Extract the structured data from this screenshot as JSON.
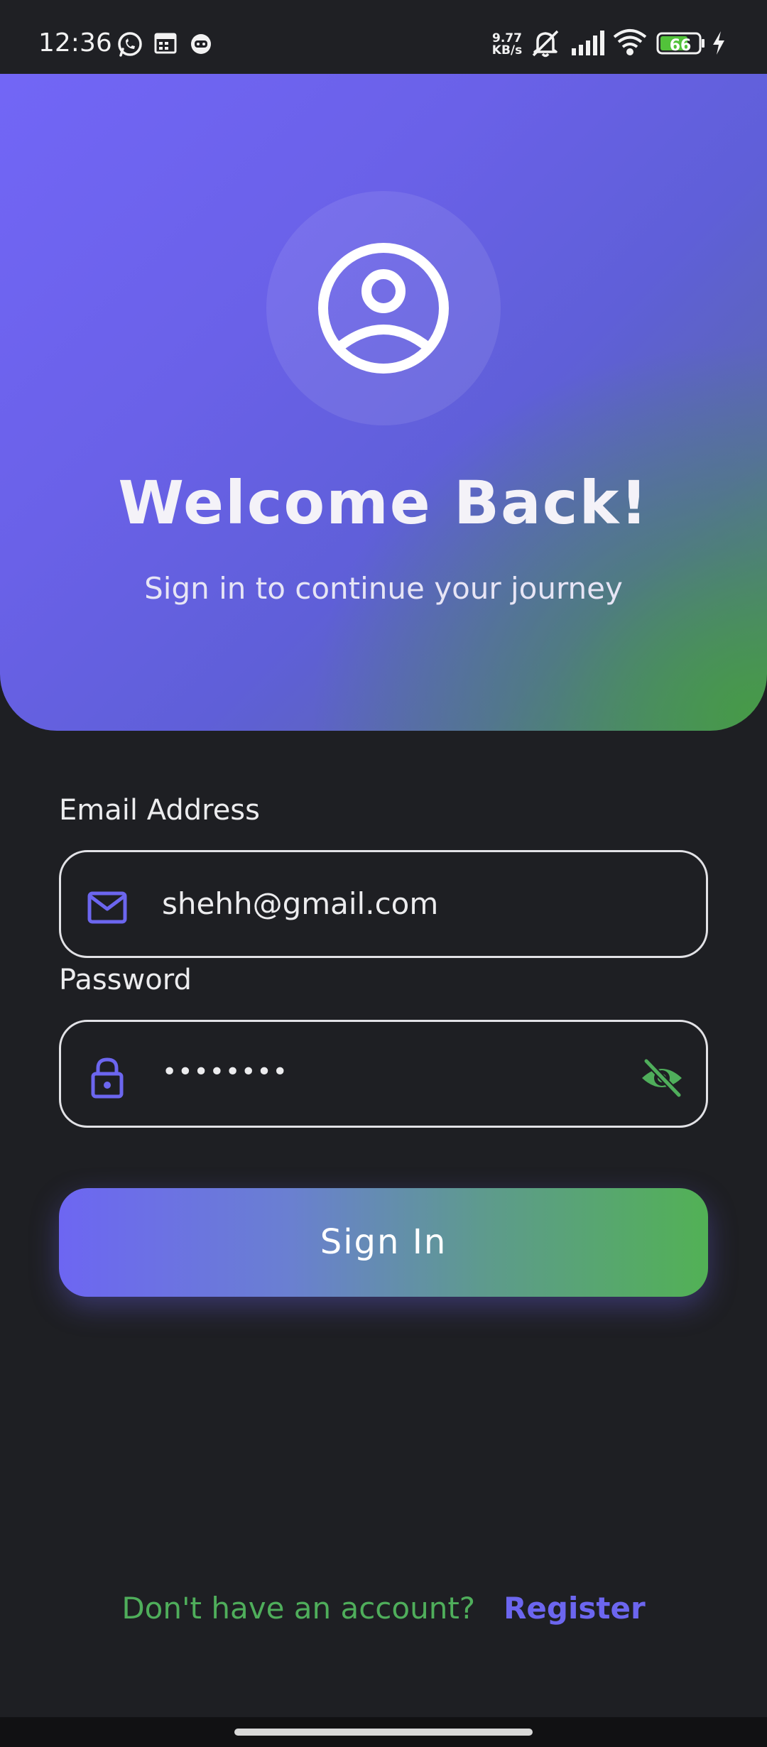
{
  "status_bar": {
    "time": "12:36",
    "net_speed_value": "9.77",
    "net_speed_unit": "KB/s",
    "battery_level": "66"
  },
  "header": {
    "title": "Welcome Back!",
    "subtitle": "Sign in to continue your journey",
    "avatar_icon": "user-circle-icon"
  },
  "form": {
    "email": {
      "label": "Email Address",
      "value": "shehh@gmail.com",
      "icon": "mail-icon"
    },
    "password": {
      "label": "Password",
      "value": "••••••••",
      "icon": "lock-icon",
      "toggle_icon": "eye-off-icon"
    },
    "submit_label": "Sign In"
  },
  "footer": {
    "prompt": "Don't have an account?",
    "register_label": "Register"
  },
  "colors": {
    "accent_purple": "#6c66ef",
    "accent_green": "#4fae5b",
    "background": "#1e1f23"
  }
}
